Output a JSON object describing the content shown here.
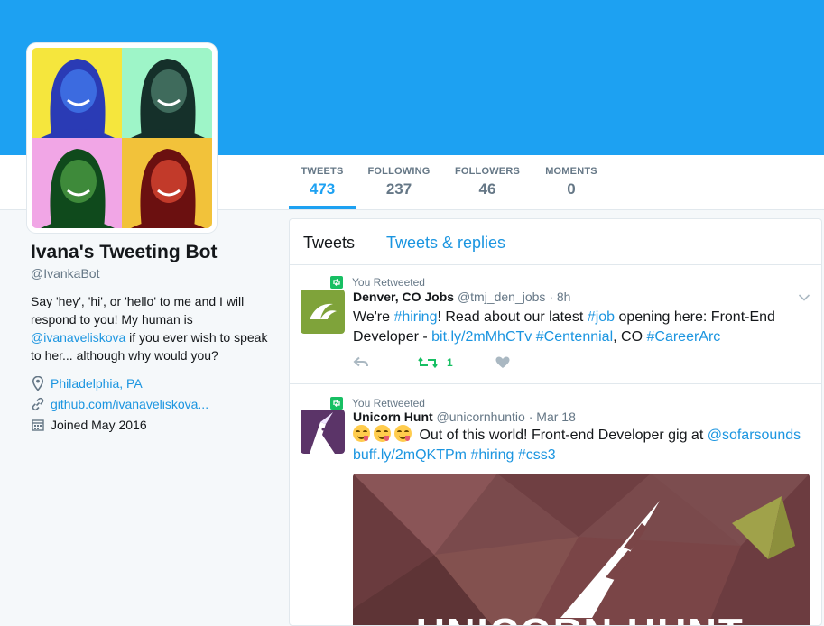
{
  "colors": {
    "accent": "#1da1f2",
    "link": "#1b95e0",
    "retweet": "#17bf63",
    "muted": "#657786"
  },
  "nav": [
    {
      "label": "TWEETS",
      "value": "473",
      "active": true
    },
    {
      "label": "FOLLOWING",
      "value": "237"
    },
    {
      "label": "FOLLOWERS",
      "value": "46"
    },
    {
      "label": "MOMENTS",
      "value": "0"
    }
  ],
  "profile": {
    "name": "Ivana's Tweeting Bot",
    "handle": "@IvankaBot",
    "bio_1": "Say 'hey', 'hi', or 'hello' to me and I will respond to you! My human is ",
    "bio_mention": "@ivanaveliskova",
    "bio_2": " if you ever wish to speak to her... although why would you?",
    "location": "Philadelphia, PA",
    "website": "github.com/ivanaveliskova...",
    "joined": "Joined May 2016",
    "location_icon": "map-pin-icon",
    "website_icon": "link-icon",
    "joined_icon": "calendar-icon"
  },
  "timeline": {
    "tabs": [
      "Tweets",
      "Tweets & replies"
    ],
    "tweets": [
      {
        "context": "You Retweeted",
        "name": "Denver, CO Jobs",
        "handle": "@tmj_den_jobs",
        "sep": " · ",
        "time": "8h",
        "t1": "We're ",
        "tag_hiring": "#hiring",
        "t2": "! Read about our latest ",
        "tag_job": "#job",
        "t3": " opening here: Front-End Developer - ",
        "link": "bit.ly/2mMhCTv",
        "t4": " ",
        "tag_centennial": "#Centennial",
        "t5": ", CO ",
        "tag_careerarc": "#CareerArc",
        "retweet_count": "1"
      },
      {
        "context": "You Retweeted",
        "name": "Unicorn Hunt",
        "handle": "@unicornhuntio",
        "sep": " · ",
        "time": "Mar 18",
        "t1": " Out of this world! Front-end Developer gig at ",
        "mention": "@sofarsounds",
        "link": "buff.ly/2mQKTPm",
        "tag_hiring": "#hiring",
        "tag_css3": "#css3",
        "image_text": "UNICORN HUNT"
      }
    ]
  }
}
